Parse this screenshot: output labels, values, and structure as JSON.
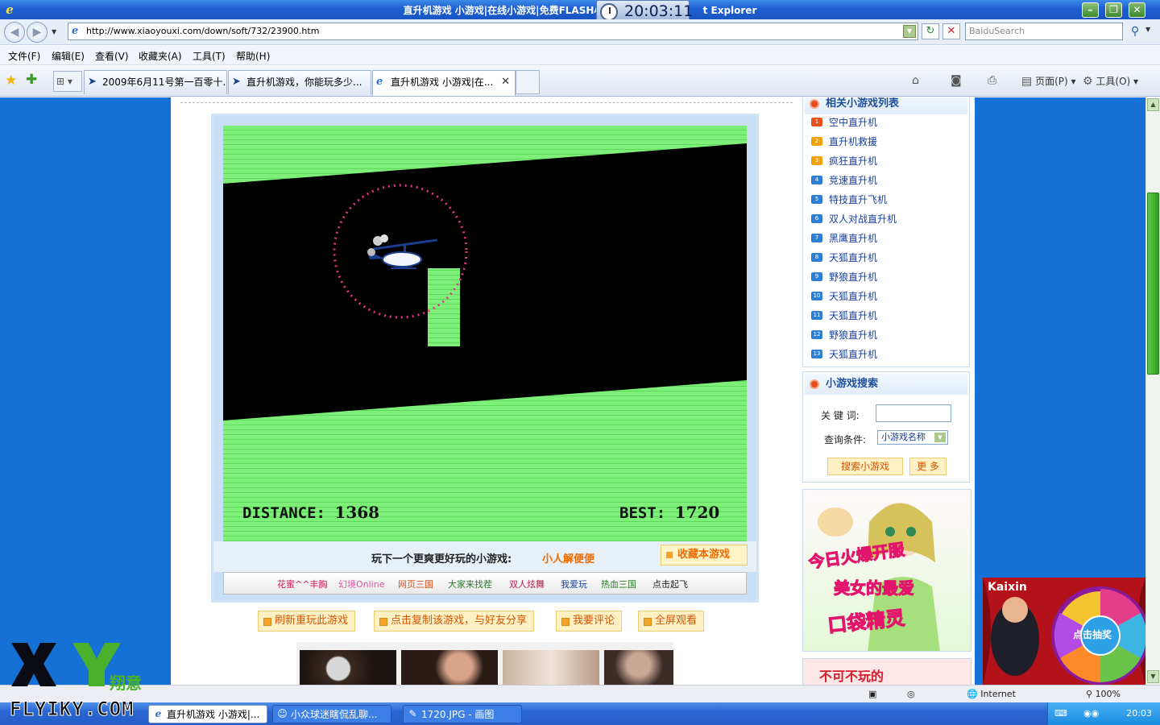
{
  "window": {
    "title": "直升机游戏 小游戏|在线小游戏|免费FLASH小游戏下载",
    "title_suffix": "t Explorer",
    "clock": "20:03:11"
  },
  "address": {
    "url": "http://www.xiaoyouxi.com/down/soft/732/23900.htm",
    "search_placeholder": "BaiduSearch"
  },
  "menu": [
    "文件(F)",
    "编辑(E)",
    "查看(V)",
    "收藏夹(A)",
    "工具(T)",
    "帮助(H)"
  ],
  "tabs": [
    {
      "label": "2009年6月11号第一百零十..."
    },
    {
      "label": "直升机游戏，你能玩多少..."
    },
    {
      "label": "直升机游戏 小游戏|在..."
    }
  ],
  "commands": {
    "page": "页面(P)",
    "tools": "工具(O)"
  },
  "game": {
    "distance_label": "DISTANCE:",
    "distance": "1368",
    "best_label": "BEST:",
    "best": "1720",
    "next_label": "玩下一个更爽更好玩的小游戏:",
    "next_game": "小人解便便",
    "fav_label": "收藏本游戏",
    "links": [
      {
        "text": "花蜜^^丰胸",
        "color": "#d4145a"
      },
      {
        "text": "幻境Online",
        "color": "#e04fa0"
      },
      {
        "text": "网页三国",
        "color": "#e0501a"
      },
      {
        "text": "大家来找茬",
        "color": "#2a7a2a"
      },
      {
        "text": "双人炫舞",
        "color": "#c2184a"
      },
      {
        "text": "我爱玩",
        "color": "#1a3f9a"
      },
      {
        "text": "热血三国",
        "color": "#2a7a2a"
      },
      {
        "text": "点击起飞",
        "color": "#222222"
      }
    ]
  },
  "actions": [
    "刷新重玩此游戏",
    "点击复制该游戏，与好友分享",
    "我要评论",
    "全屏观看"
  ],
  "related": {
    "title": "相关小游戏列表",
    "items": [
      "空中直升机",
      "直升机救援",
      "疯狂直升机",
      "竞速直升机",
      "特技直升飞机",
      "双人对战直升机",
      "黑鹰直升机",
      "天狐直升机",
      "野狼直升机",
      "天狐直升机",
      "天狐直升机",
      "野狼直升机",
      "天狐直升机"
    ]
  },
  "search": {
    "title": "小游戏搜索",
    "keyword_label": "关 键 词:",
    "condition_label": "查询条件:",
    "condition_value": "小游戏名称",
    "search_btn": "搜索小游戏",
    "more_btn": "更 多"
  },
  "ads": {
    "anime_text1": "今日火爆开服",
    "anime_text2": "美女的最爱",
    "anime_text3": "口袋精灵",
    "bottom_text": "不可不玩的",
    "kaixin_brand": "Kaixin",
    "kaixin_cta": "点击抽奖"
  },
  "status": {
    "zone": "Internet",
    "zoom": "100%"
  },
  "taskbar": {
    "tasks": [
      "直升机游戏 小游戏|...",
      "小众球迷瞎侃乱聊...",
      "1720.JPG - 画图"
    ],
    "time": "20:03"
  },
  "watermark": {
    "brand": "FLYIKY.COM",
    "letters": "XY",
    "cn": "翔意"
  }
}
